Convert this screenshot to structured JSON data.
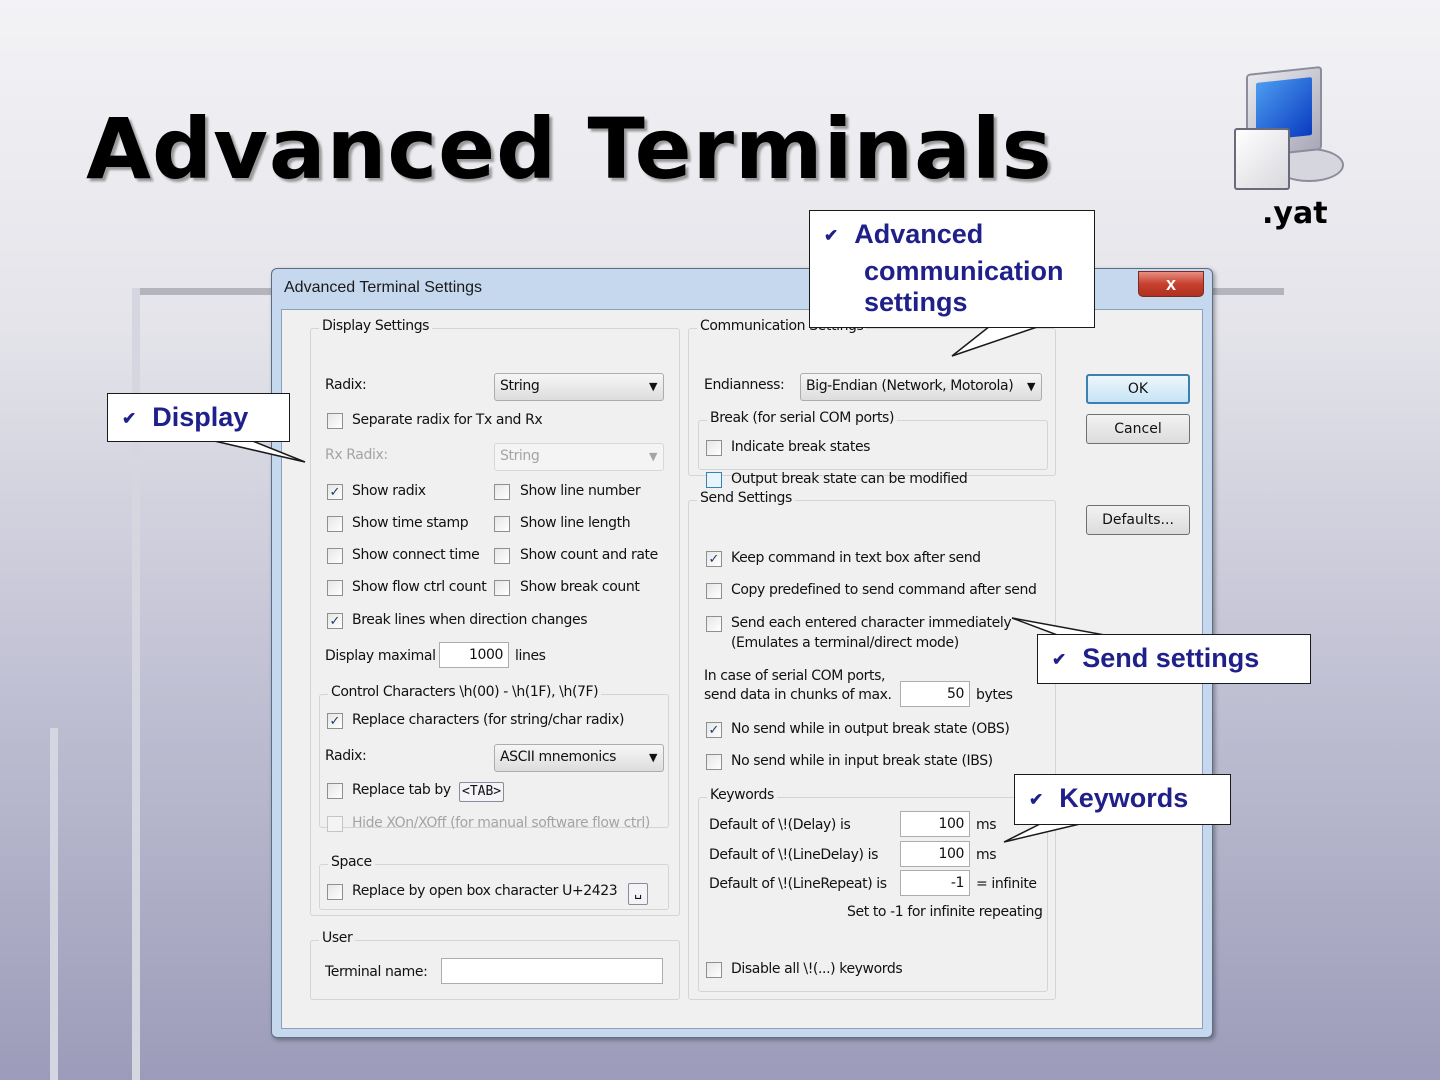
{
  "slide": {
    "title": "Advanced Terminals",
    "logo_ext": ".yat"
  },
  "dialog": {
    "title": "Advanced Terminal Settings",
    "close_glyph": "x",
    "display": {
      "legend": "Display Settings",
      "radix_label": "Radix:",
      "radix_value": "String",
      "separate_radix": "Separate radix for Tx and Rx",
      "rx_radix_label": "Rx Radix:",
      "rx_radix_value": "String",
      "show_radix": "Show radix",
      "show_line_number": "Show line number",
      "show_time_stamp": "Show time stamp",
      "show_line_length": "Show line length",
      "show_connect_time": "Show connect time",
      "show_count_rate": "Show count and rate",
      "show_flow_ctrl": "Show flow ctrl count",
      "show_break_count": "Show break count",
      "break_lines": "Break lines when direction changes",
      "display_maximal_label": "Display maximal",
      "display_maximal_value": "1000",
      "lines_unit": "lines"
    },
    "control": {
      "legend": "Control Characters \\h(00) - \\h(1F), \\h(7F)",
      "replace_chars": "Replace characters (for string/char radix)",
      "radix_label": "Radix:",
      "radix_value": "ASCII mnemonics",
      "replace_tab": "Replace tab by",
      "tab_token": "<TAB>",
      "hide_xon": "Hide XOn/XOff (for manual software flow ctrl)"
    },
    "space": {
      "legend": "Space",
      "replace_box": "Replace by open box character U+2423",
      "box_glyph": "␣"
    },
    "user": {
      "legend": "User",
      "terminal_name_label": "Terminal name:",
      "terminal_name_value": ""
    },
    "communication": {
      "legend": "Communication Settings",
      "endianness_label": "Endianness:",
      "endianness_value": "Big-Endian (Network, Motorola)",
      "break_legend": "Break (for serial COM ports)",
      "indicate_break": "Indicate break states",
      "output_break": "Output break state can be modified"
    },
    "send": {
      "legend": "Send Settings",
      "keep_command": "Keep command in text box after send",
      "copy_predefined": "Copy predefined to send command after send",
      "send_each_1": "Send each entered character immediately",
      "send_each_2": "(Emulates a terminal/direct mode)",
      "chunk_line1": "In case of serial COM ports,",
      "chunk_line2": "send data in chunks of max.",
      "chunk_value": "50",
      "chunk_unit": "bytes",
      "no_send_obs": "No send while in output break state (OBS)",
      "no_send_ibs": "No send while in input break state (IBS)"
    },
    "keywords": {
      "legend": "Keywords",
      "delay_label": "Default of \\!(Delay) is",
      "delay_value": "100",
      "delay_unit": "ms",
      "linedelay_label": "Default of \\!(LineDelay) is",
      "linedelay_value": "100",
      "linedelay_unit": "ms",
      "linerepeat_label": "Default of \\!(LineRepeat) is",
      "linerepeat_value": "-1",
      "linerepeat_unit": "= infinite",
      "hint": "Set to -1 for infinite repeating",
      "disable_all": "Disable all \\!(...) keywords"
    },
    "buttons": {
      "ok": "OK",
      "cancel": "Cancel",
      "defaults": "Defaults..."
    },
    "checks": {
      "separate_radix": false,
      "show_radix": true,
      "show_line_number": false,
      "show_time_stamp": false,
      "show_line_length": false,
      "show_connect_time": false,
      "show_count_rate": false,
      "show_flow_ctrl": false,
      "show_break_count": false,
      "break_lines": true,
      "replace_chars": true,
      "replace_tab": false,
      "hide_xon": false,
      "replace_box": false,
      "indicate_break": false,
      "output_break": false,
      "keep_command": true,
      "copy_predefined": false,
      "send_each": false,
      "no_send_obs": true,
      "no_send_ibs": false,
      "disable_all": false
    }
  },
  "callouts": {
    "display": "Display",
    "communication_1": "Advanced",
    "communication_2": "communication",
    "communication_3": "settings",
    "send": "Send settings",
    "keywords": "Keywords",
    "bullet": "✔"
  }
}
